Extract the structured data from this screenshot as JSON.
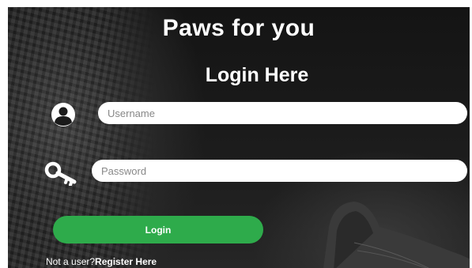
{
  "site": {
    "title": "Paws for you"
  },
  "login_form": {
    "heading": "Login Here",
    "username": {
      "placeholder": "Username",
      "value": "",
      "icon": "user-icon"
    },
    "password": {
      "placeholder": "Password",
      "value": "",
      "icon": "key-icon"
    },
    "submit_label": "Login",
    "register_prompt": "Not a user?",
    "register_link": "Register Here"
  },
  "colors": {
    "button_green": "#2eab4b",
    "field_bg": "#ffffff",
    "text": "#ffffff"
  }
}
